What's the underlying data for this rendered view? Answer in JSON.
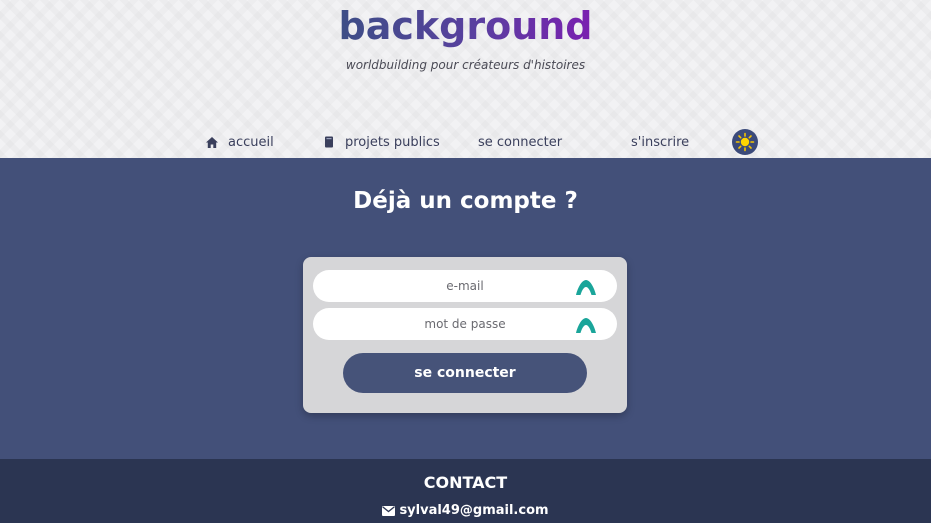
{
  "header": {
    "brand": "background",
    "tagline": "worldbuilding pour créateurs d'histoires",
    "nav": [
      {
        "label": "accueil",
        "icon": "home-icon"
      },
      {
        "label": "projets publics",
        "icon": "book-icon"
      },
      {
        "label": "se connecter"
      },
      {
        "label": "s'inscrire"
      }
    ],
    "theme_toggle_icon": "sun-icon"
  },
  "main": {
    "title": "Déjà un compte ?",
    "email_placeholder": "e-mail",
    "password_placeholder": "mot de passe",
    "submit_label": "se connecter"
  },
  "footer": {
    "title": "CONTACT",
    "email": "sylval49@gmail.com",
    "email_icon": "envelope-icon"
  },
  "colors": {
    "brand_gradient_start": "#3d4e86",
    "brand_gradient_end": "#7a1fb0",
    "main_bg": "#435079",
    "footer_bg": "#2b3552",
    "field_icon": "#1aa59a"
  }
}
